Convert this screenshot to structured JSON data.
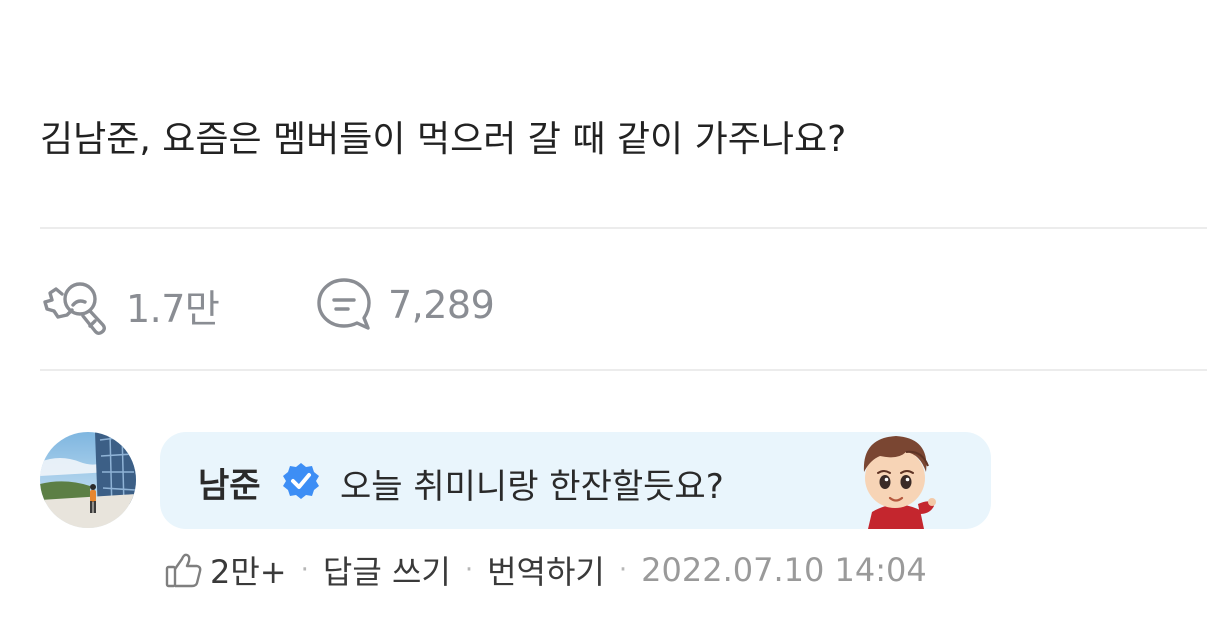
{
  "post": {
    "text": "김남준, 요즘은 멤버들이 먹으러 갈 때 같이 가주나요?"
  },
  "stats": {
    "likes": "1.7만",
    "comments": "7,289"
  },
  "reply": {
    "author": "남준",
    "message": "오늘 취미니랑 한잔할듯요?",
    "like_count": "2만+",
    "reply_label": "답글 쓰기",
    "translate_label": "번역하기",
    "timestamp": "2022.07.10 14:04",
    "separator": "·"
  },
  "icons": {
    "like_icon": "cheer-hand-icon",
    "comment_icon": "speech-bubble-icon",
    "verified_icon": "verified-badge-icon",
    "reply_like_icon": "thumb-up-icon"
  },
  "colors": {
    "accent_blue": "#3d8ef5",
    "bubble_bg": "#e9f5fc",
    "muted_gray": "#8a8d93"
  }
}
